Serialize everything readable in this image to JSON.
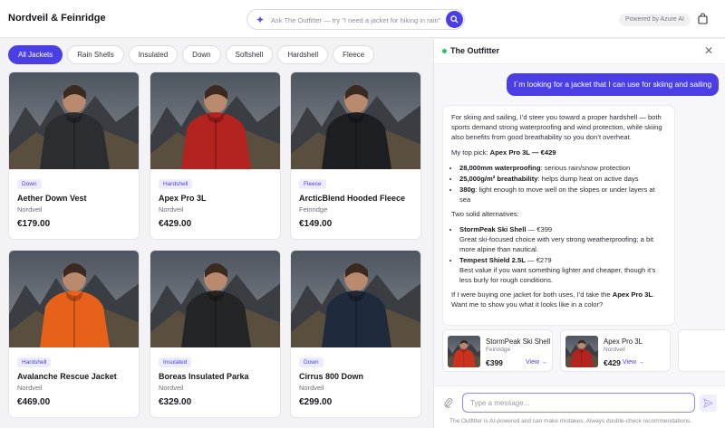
{
  "header": {
    "brand": "Nordveil & Feinridge",
    "search_placeholder": "Ask The Outfitter — try \"I need a jacket for hiking in rain\"",
    "powered_by": "Powered by Azure AI",
    "icons": {
      "search": "sparkle-icon",
      "submit": "search-icon",
      "cart": "shopping-bag-icon"
    }
  },
  "filters": [
    "All Jackets",
    "Rain Shells",
    "Insulated",
    "Down",
    "Softshell",
    "Hardshell",
    "Fleece"
  ],
  "active_filter": "All Jackets",
  "products": [
    {
      "tag": "Down",
      "name": "Aether Down Vest",
      "maker": "Nordveil",
      "price": "€179.00",
      "jacket_color": "#2b2d30"
    },
    {
      "tag": "Hardshell",
      "name": "Apex Pro 3L",
      "maker": "Nordveil",
      "price": "€429.00",
      "jacket_color": "#b3231f"
    },
    {
      "tag": "Fleece",
      "name": "ArcticBlend Hooded Fleece",
      "maker": "Feinridge",
      "price": "€149.00",
      "jacket_color": "#1d1e21"
    },
    {
      "tag": "Hardshell",
      "name": "Avalanche Rescue Jacket",
      "maker": "Nordveil",
      "price": "€469.00",
      "jacket_color": "#e8611b"
    },
    {
      "tag": "Insulated",
      "name": "Boreas Insulated Parka",
      "maker": "Nordveil",
      "price": "€329.00",
      "jacket_color": "#242526"
    },
    {
      "tag": "Down",
      "name": "Cirrus 800 Down",
      "maker": "Nordveil",
      "price": "€299.00",
      "jacket_color": "#1f2a3d"
    }
  ],
  "chat": {
    "title": "The Outfitter",
    "user_message": "I´m looking for a jacket that I can use for skiing and sailing",
    "bot": {
      "intro": "For skiing and sailing, I’d steer you toward a proper hardshell — both sports demand strong waterproofing and wind protection, while skiing also benefits from good breathability so you don’t overheat.",
      "pick_label": "My top pick:",
      "pick_value": "Apex Pro 3L — €429",
      "features": [
        {
          "bold": "28,000mm waterproofing",
          "text": ": serious rain/snow protection"
        },
        {
          "bold": "25,000g/m² breathability",
          "text": ": helps dump heat on active days"
        },
        {
          "bold": "380g",
          "text": ": light enough to move well on the slopes or under layers at sea"
        }
      ],
      "alt_heading": "Two solid alternatives:",
      "alternatives": [
        {
          "bold": "StormPeak Ski Shell",
          "price": " — €399",
          "text": "Great ski-focused choice with very strong weatherproofing; a bit more alpine than nautical."
        },
        {
          "bold": "Tempest Shield 2.5L",
          "price": " — €279",
          "text": "Best value if you want something lighter and cheaper, though it’s less burly for rough conditions."
        }
      ],
      "closing_a": "If I were buying one jacket for both uses, I’d take the ",
      "closing_bold": "Apex Pro 3L",
      "closing_b": ". Want me to show you what it looks like in a color?"
    },
    "recommendations": [
      {
        "name": "StormPeak Ski Shell",
        "maker": "Feinridge",
        "price": "€399",
        "view": "View →",
        "jacket_color": "#c8321e"
      },
      {
        "name": "Apex Pro 3L",
        "maker": "Nordveil",
        "price": "€429",
        "view": "View →",
        "jacket_color": "#b3231f"
      }
    ],
    "input_placeholder": "Type a message...",
    "disclaimer": "The Outfitter is AI-powered and can make mistakes. Always double-check recommendations."
  }
}
